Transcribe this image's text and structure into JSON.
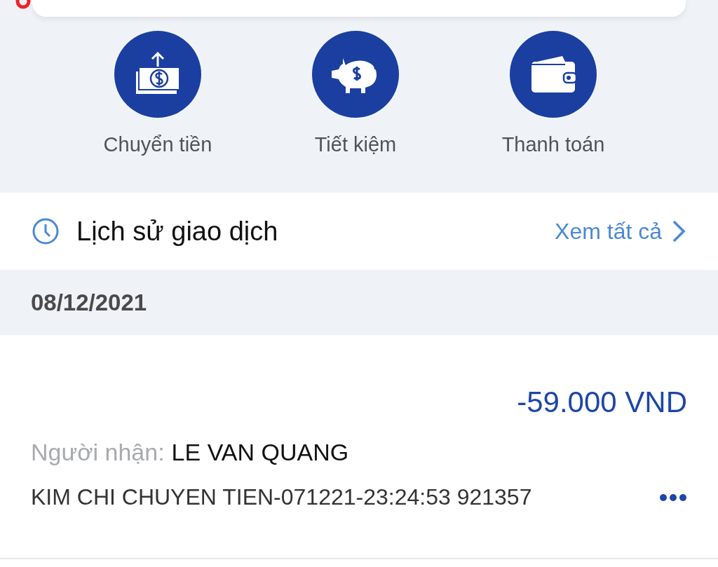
{
  "shortcuts": [
    {
      "kind": "transfer",
      "label": "Chuyển tiền"
    },
    {
      "kind": "savings",
      "label": "Tiết kiệm"
    },
    {
      "kind": "payment",
      "label": "Thanh toán"
    }
  ],
  "history": {
    "title": "Lịch sử giao dịch",
    "link": "Xem tất cả"
  },
  "date": "08/12/2021",
  "transaction": {
    "amount": "-59.000 VND",
    "recipient_label": "Người nhận:",
    "recipient": "LE VAN QUANG",
    "memo": "KIM CHI CHUYEN TIEN-071221-23:24:53 921357"
  }
}
